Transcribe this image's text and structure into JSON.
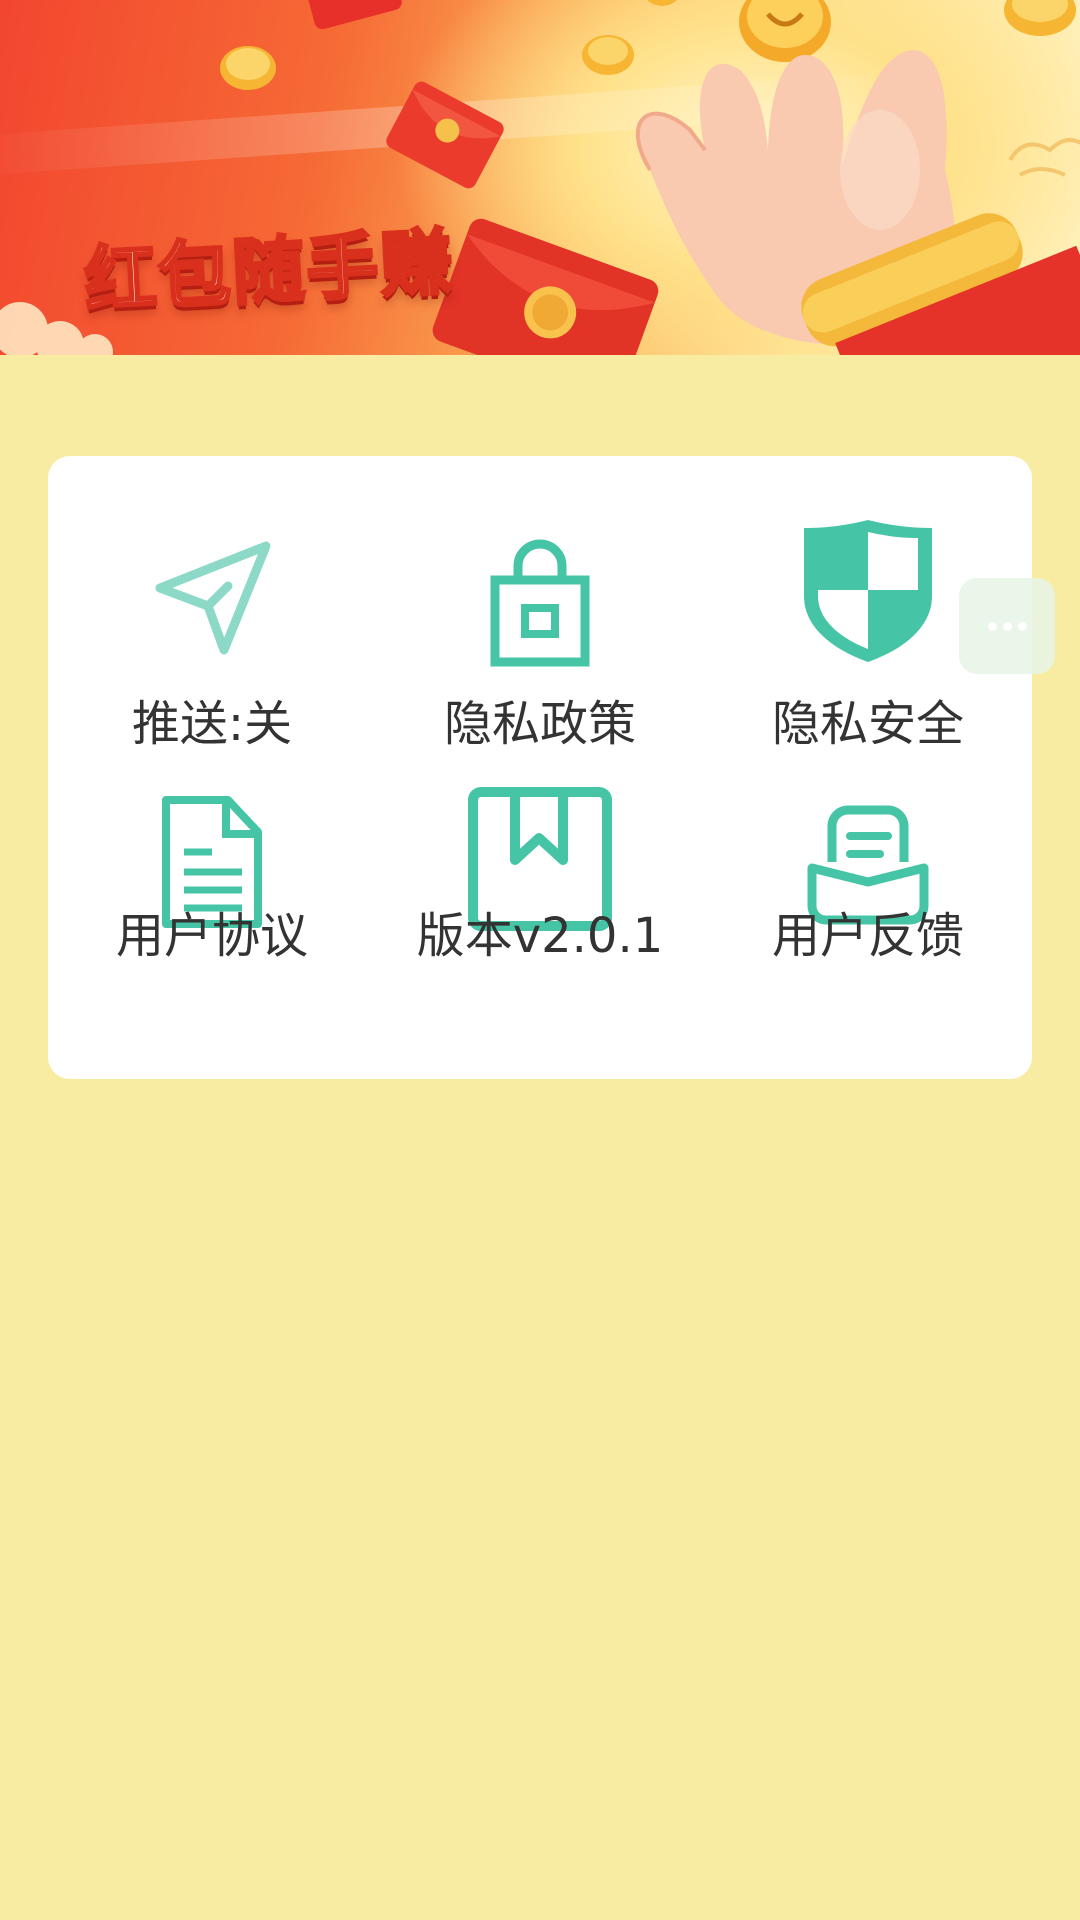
{
  "banner": {
    "title": "红包随手赚"
  },
  "menu": {
    "items": [
      {
        "label": "推送:关",
        "icon": "send-icon"
      },
      {
        "label": "隐私政策",
        "icon": "lock-icon"
      },
      {
        "label": "隐私安全",
        "icon": "shield-icon"
      },
      {
        "label": "用户协议",
        "icon": "document-icon"
      },
      {
        "label": "版本v2.0.1",
        "icon": "bookmark-icon"
      },
      {
        "label": "用户反馈",
        "icon": "feedback-tray-icon"
      }
    ]
  },
  "floating": {
    "icon": "more-dots-icon"
  },
  "colors": {
    "accent": "#46c4a6",
    "accent_light": "#8bd9c6",
    "background": "#f8eca3",
    "card": "#ffffff",
    "text": "#333333"
  }
}
